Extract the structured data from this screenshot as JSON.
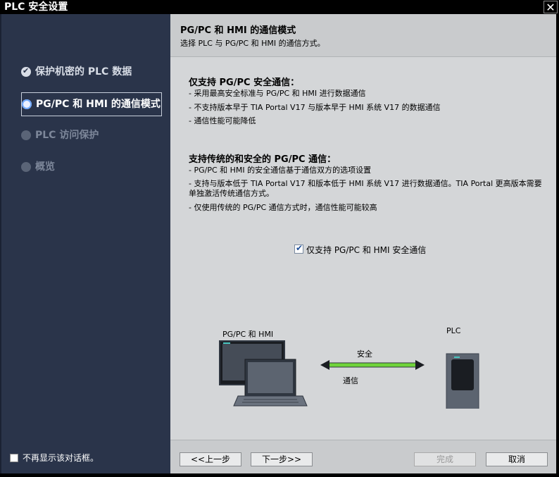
{
  "window": {
    "title": "PLC 安全设置",
    "close_label": "✕"
  },
  "sidebar": {
    "steps": [
      {
        "label": "保护机密的 PLC 数据",
        "state": "done"
      },
      {
        "label": "PG/PC 和 HMI 的通信模式",
        "state": "active"
      },
      {
        "label": "PLC 访问保护",
        "state": "pending"
      },
      {
        "label": "概览",
        "state": "pending"
      }
    ],
    "no_show_label": "不再显示该对话框。",
    "no_show_checked": false
  },
  "header": {
    "title": "PG/PC 和 HMI 的通信模式",
    "subtitle": "选择 PLC 与 PG/PC 和 HMI 的通信方式。"
  },
  "content": {
    "section1": {
      "title": "仅支持 PG/PC 安全通信：",
      "lines": [
        "- 采用最高安全标准与 PG/PC 和 HMI 进行数据通信",
        "- 不支持版本早于 TIA Portal V17 与版本早于 HMI 系统 V17 的数据通信",
        "- 通信性能可能降低"
      ]
    },
    "section2": {
      "title": "支持传统的和安全的 PG/PC 通信：",
      "lines": [
        "- PG/PC 和 HMI 的安全通信基于通信双方的选项设置",
        "- 支持与版本低于 TIA Portal V17 和版本低于 HMI 系统 V17 进行数据通信。TIA Portal 更高版本需要单独激活传统通信方式。",
        "- 仅使用传统的 PG/PC 通信方式时，通信性能可能较高"
      ]
    },
    "option": {
      "label": "仅支持 PG/PC 和 HMI 安全通信",
      "checked": true
    }
  },
  "illustration": {
    "left_label": "PG/PC 和 HMI",
    "right_label": "PLC",
    "arrow_top_label": "安全",
    "arrow_bottom_label": "通信",
    "link_color": "#6fd43a"
  },
  "footer": {
    "back_label": "<<上一步",
    "next_label": "下一步>>",
    "finish_label": "完成",
    "cancel_label": "取消"
  },
  "colors": {
    "sidebar_bg": "#2a344a",
    "main_bg": "#d4d6d8",
    "accent": "#6fa8ff"
  }
}
